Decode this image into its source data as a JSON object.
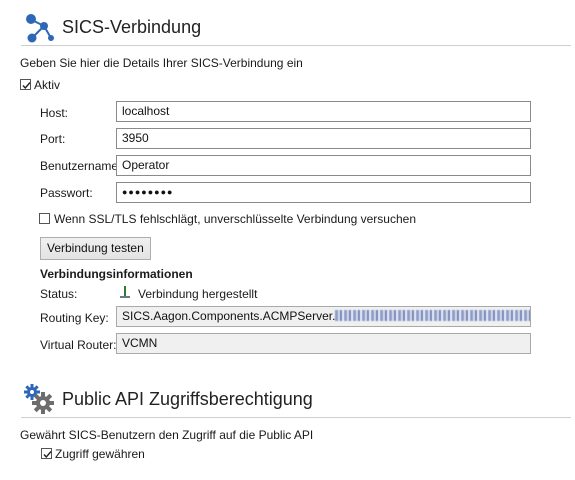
{
  "sics": {
    "title": "SICS-Verbindung",
    "description": "Geben Sie hier die Details Ihrer SICS-Verbindung ein",
    "active_label": "Aktiv",
    "active_checked": true,
    "host_label": "Host:",
    "host_value": "localhost",
    "port_label": "Port:",
    "port_value": "3950",
    "user_label": "Benutzername:",
    "user_value": "Operator",
    "password_label": "Passwort:",
    "password_value": "●●●●●●●●",
    "ssl_fallback_label": "Wenn SSL/TLS fehlschlägt, unverschlüsselte Verbindung versuchen",
    "ssl_fallback_checked": false,
    "test_button": "Verbindung testen"
  },
  "connection_info": {
    "heading": "Verbindungsinformationen",
    "status_label": "Status:",
    "status_value": "Verbindung hergestellt",
    "routing_key_label": "Routing Key:",
    "routing_key_value": "SICS.Aagon.Components.ACMPServer.",
    "virtual_router_label": "Virtual Router:",
    "virtual_router_value": "VCMN"
  },
  "public_api": {
    "title": "Public API Zugriffsberechtigung",
    "description": "Gewährt SICS-Benutzern den Zugriff auf die Public API",
    "grant_label": "Zugriff gewähren",
    "grant_checked": true
  },
  "colors": {
    "accent": "#2b6cb0",
    "status_icon": "#2e7d32"
  }
}
